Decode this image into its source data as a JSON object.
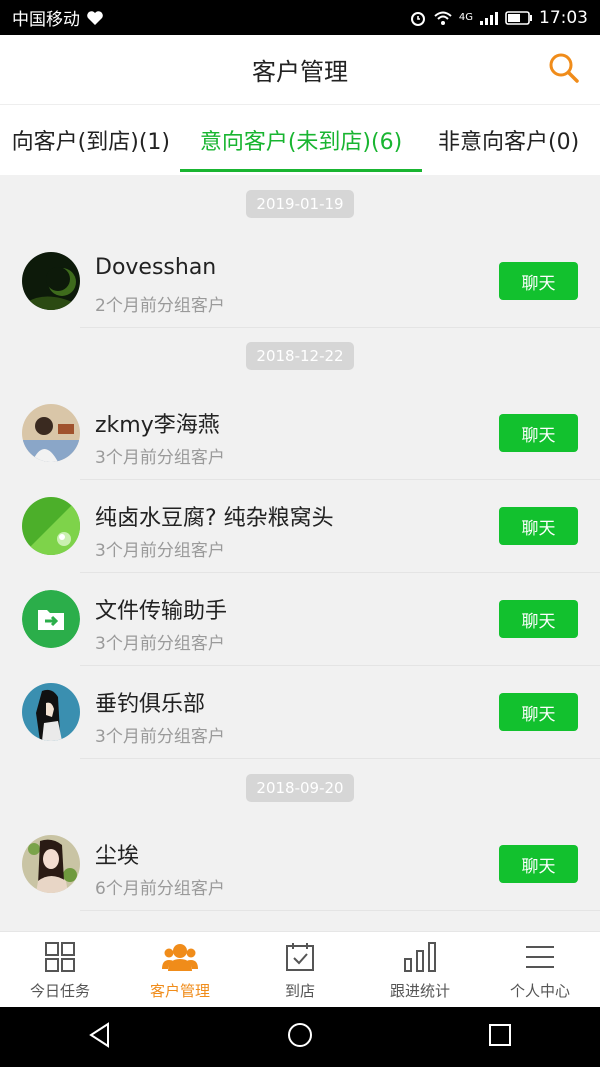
{
  "status_bar": {
    "carrier": "中国移动",
    "network": "4G",
    "time": "17:03"
  },
  "header": {
    "title": "客户管理"
  },
  "tabs": [
    {
      "label": "向客户(到店)(1)"
    },
    {
      "label": "意向客户(未到店)(6)"
    },
    {
      "label": "非意向客户(0)"
    }
  ],
  "colors": {
    "accent_green": "#19b531",
    "accent_orange": "#f08c1a"
  },
  "list": {
    "groups": [
      {
        "date": "2019-01-19",
        "items": [
          {
            "name": "Dovesshan",
            "sub": "2个月前分组客户",
            "action": "聊天"
          }
        ]
      },
      {
        "date": "2018-12-22",
        "items": [
          {
            "name": "zkmy李海燕",
            "sub": "3个月前分组客户",
            "action": "聊天"
          },
          {
            "name": "纯卤水豆腐? 纯杂粮窝头",
            "sub": "3个月前分组客户",
            "action": "聊天"
          },
          {
            "name": "文件传输助手",
            "sub": "3个月前分组客户",
            "action": "聊天"
          },
          {
            "name": "垂钓俱乐部",
            "sub": "3个月前分组客户",
            "action": "聊天"
          }
        ]
      },
      {
        "date": "2018-09-20",
        "items": [
          {
            "name": "尘埃",
            "sub": "6个月前分组客户",
            "action": "聊天"
          }
        ]
      }
    ]
  },
  "bottom_nav": [
    {
      "label": "今日任务",
      "icon": "grid-icon"
    },
    {
      "label": "客户管理",
      "icon": "people-icon"
    },
    {
      "label": "到店",
      "icon": "calendar-check-icon"
    },
    {
      "label": "跟进统计",
      "icon": "bar-chart-icon"
    },
    {
      "label": "个人中心",
      "icon": "menu-icon"
    }
  ]
}
